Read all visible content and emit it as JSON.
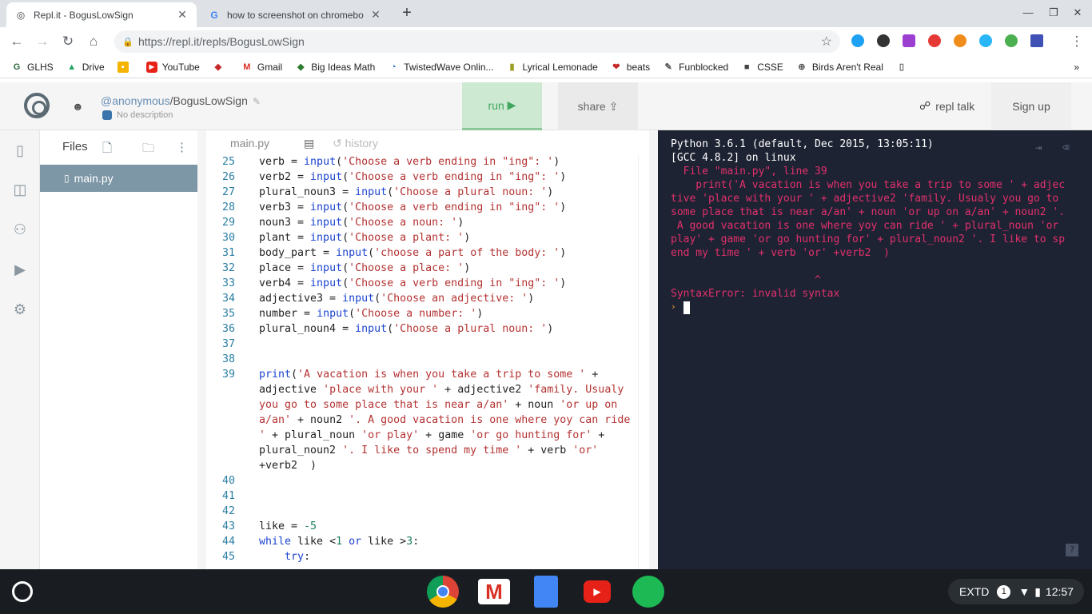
{
  "browser": {
    "tabs": [
      {
        "title": "Repl.it - BogusLowSign",
        "active": true
      },
      {
        "title": "how to screenshot on chromebo",
        "active": false
      }
    ],
    "url": "https://repl.it/repls/BogusLowSign",
    "bookmarks": [
      "GLHS",
      "Drive",
      "",
      "YouTube",
      "",
      "Gmail",
      "Big Ideas Math",
      "TwistedWave Onlin...",
      "Lyrical Lemonade",
      "beats",
      "Funblocked",
      "CSSE",
      "Birds Aren't Real",
      ""
    ]
  },
  "app": {
    "user": "@anonymous",
    "repl_name": "BogusLowSign",
    "description": "No description",
    "run_label": "run",
    "share_label": "share",
    "repl_talk_label": "repl talk",
    "signup_label": "Sign up"
  },
  "files": {
    "header": "Files",
    "items": [
      "main.py"
    ]
  },
  "editor": {
    "tabs": {
      "main": "main.py",
      "history": "history"
    },
    "lines": [
      {
        "n": "25",
        "html": "verb = <span class='kw'>input</span>(<span class='str'>'Choose a verb ending in \"ing\": '</span>)"
      },
      {
        "n": "26",
        "html": "verb2 = <span class='kw'>input</span>(<span class='str'>'Choose a verb ending in \"ing\": '</span>)"
      },
      {
        "n": "27",
        "html": "plural_noun3 = <span class='kw'>input</span>(<span class='str'>'Choose a plural noun: '</span>)"
      },
      {
        "n": "28",
        "html": "verb3 = <span class='kw'>input</span>(<span class='str'>'Choose a verb ending in \"ing\": '</span>)"
      },
      {
        "n": "29",
        "html": "noun3 = <span class='kw'>input</span>(<span class='str'>'Choose a noun: '</span>)"
      },
      {
        "n": "30",
        "html": "plant = <span class='kw'>input</span>(<span class='str'>'Choose a plant: '</span>)"
      },
      {
        "n": "31",
        "html": "body_part = <span class='kw'>input</span>(<span class='str'>'choose a part of the body: '</span>)"
      },
      {
        "n": "32",
        "html": "place = <span class='kw'>input</span>(<span class='str'>'Choose a place: '</span>)"
      },
      {
        "n": "33",
        "html": "verb4 = <span class='kw'>input</span>(<span class='str'>'Choose a verb ending in \"ing\": '</span>)"
      },
      {
        "n": "34",
        "html": "adjective3 = <span class='kw'>input</span>(<span class='str'>'Choose an adjective: '</span>)"
      },
      {
        "n": "35",
        "html": "number = <span class='kw'>input</span>(<span class='str'>'Choose a number: '</span>)"
      },
      {
        "n": "36",
        "html": "plural_noun4 = <span class='kw'>input</span>(<span class='str'>'Choose a plural noun: '</span>)"
      },
      {
        "n": "37",
        "html": ""
      },
      {
        "n": "38",
        "html": ""
      },
      {
        "n": "39",
        "html": "<span class='kw'>print</span>(<span class='str'>'A vacation is when you take a trip to some '</span> +"
      },
      {
        "n": "",
        "html": "adjective <span class='str'>'place with your '</span> + adjective2 <span class='str'>'family. Usualy</span>"
      },
      {
        "n": "",
        "html": "<span class='str'>you go to some place that is near a/an'</span> + noun <span class='str'>'or up on</span>"
      },
      {
        "n": "",
        "html": "<span class='str'>a/an'</span> + noun2 <span class='str'>'. A good vacation is one where yoy can ride</span>"
      },
      {
        "n": "",
        "html": "<span class='str'>'</span> + plural_noun <span class='str'>'or play'</span> + game <span class='str'>'or go hunting for'</span> +"
      },
      {
        "n": "",
        "html": "plural_noun2 <span class='str'>'. I like to spend my time '</span> + verb <span class='str'>'or'</span>"
      },
      {
        "n": "",
        "html": "+verb2  )"
      },
      {
        "n": "40",
        "html": ""
      },
      {
        "n": "41",
        "html": ""
      },
      {
        "n": "42",
        "html": ""
      },
      {
        "n": "43",
        "html": "like = <span class='num'>-5</span>"
      },
      {
        "n": "44",
        "html": "<span class='kw'>while</span> like &lt;<span class='num'>1</span> <span class='kw'>or</span> like &gt;<span class='num'>3</span>:"
      },
      {
        "n": "45",
        "html": "    <span class='kw'>try</span>:"
      }
    ]
  },
  "console": {
    "lines": [
      {
        "text": "Python 3.6.1 (default, Dec 2015, 13:05:11)",
        "err": false
      },
      {
        "text": "[GCC 4.8.2] on linux",
        "err": false
      },
      {
        "text": "  File \"main.py\", line 39",
        "err": true
      },
      {
        "text": "    print('A vacation is when you take a trip to some ' + adjec",
        "err": true
      },
      {
        "text": "tive 'place with your ' + adjective2 'family. Usualy you go to",
        "err": true
      },
      {
        "text": "some place that is near a/an' + noun 'or up on a/an' + noun2 '.",
        "err": true
      },
      {
        "text": " A good vacation is one where yoy can ride ' + plural_noun 'or",
        "err": true
      },
      {
        "text": "play' + game 'or go hunting for' + plural_noun2 '. I like to sp",
        "err": true
      },
      {
        "text": "end my time ' + verb 'or' +verb2  )",
        "err": true
      },
      {
        "text": "",
        "err": true
      },
      {
        "text": "                       ^",
        "err": true
      },
      {
        "text": "SyntaxError: invalid syntax",
        "err": true
      }
    ],
    "help": "?"
  },
  "shelf": {
    "extd": "EXTD",
    "badge": "1",
    "time": "12:57"
  }
}
